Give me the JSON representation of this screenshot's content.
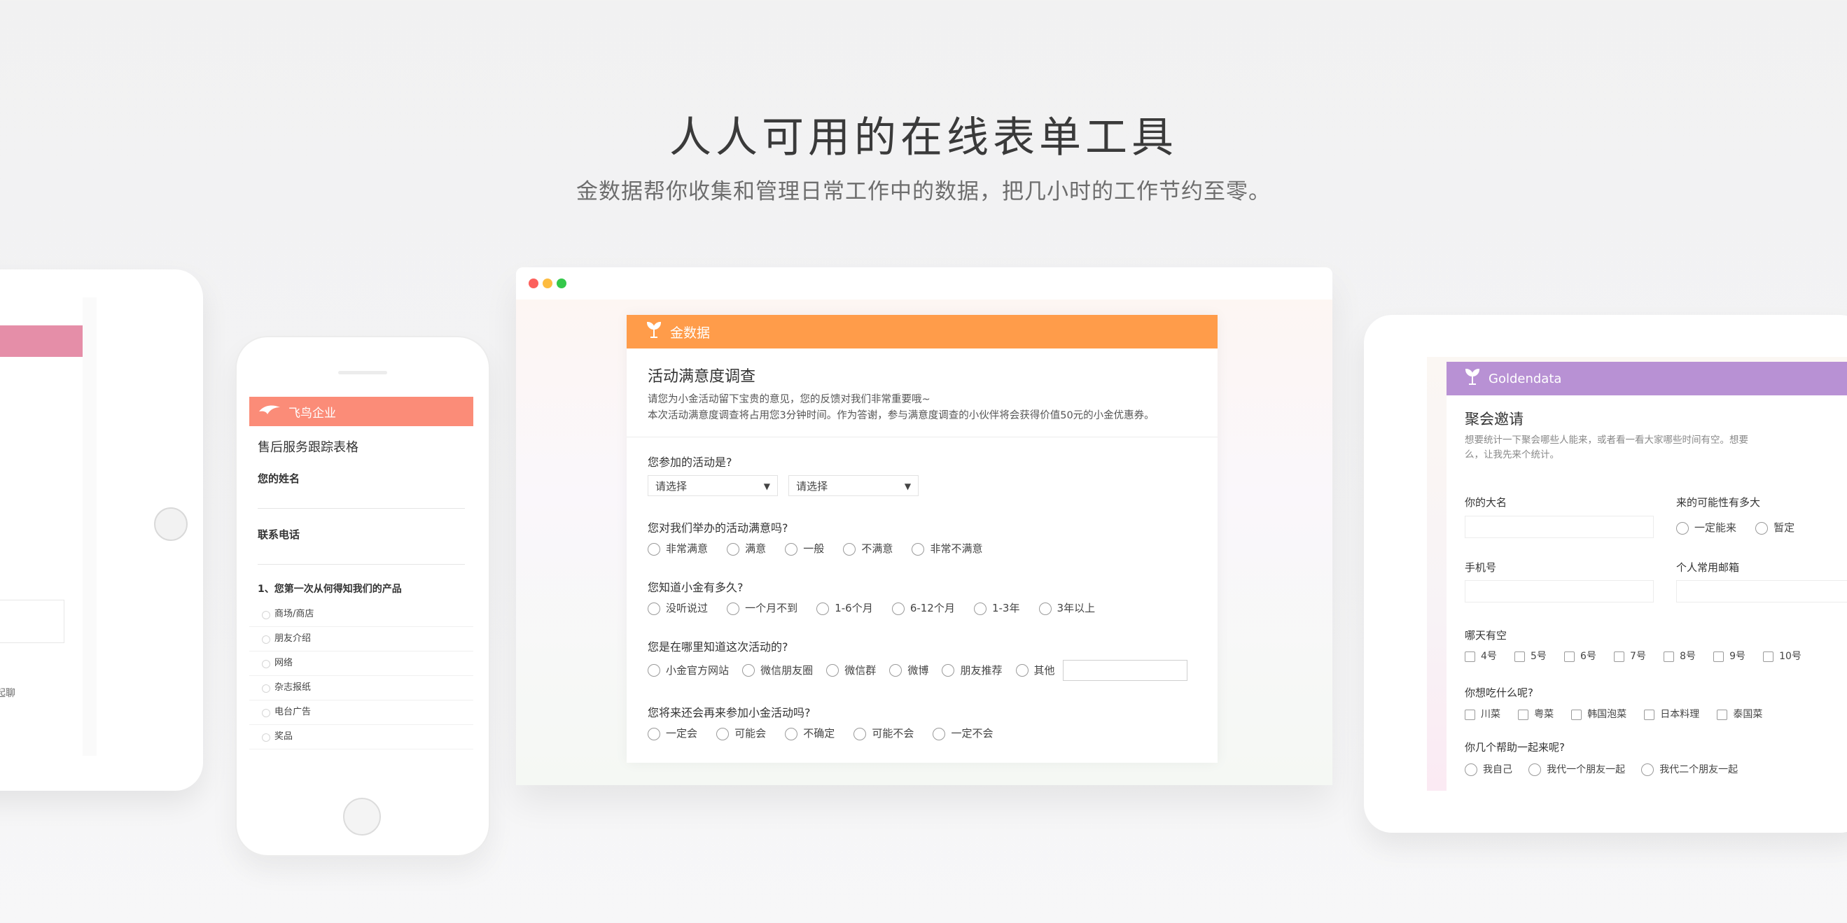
{
  "hero": {
    "title": "人人可用的在线表单工具",
    "subtitle": "金数据帮你收集和管理日常工作中的数据，把几小时的工作节约至零。"
  },
  "colors": {
    "phone_header": "#fb8c78",
    "browser_header": "#ff9c4a",
    "tablet_header": "#b891d4",
    "left_tablet_header": "#e58ea8"
  },
  "left_tablet": {
    "fragment_text": "一起聊"
  },
  "phone": {
    "logo_icon": "bird-logo-icon",
    "brand": "飞鸟企业",
    "form_title": "售后服务跟踪表格",
    "fields": [
      {
        "label": "您的姓名"
      },
      {
        "label": "联系电话"
      }
    ],
    "question": "1、您第一次从何得知我们的产品",
    "options": [
      "商场/商店",
      "朋友介绍",
      "网络",
      "杂志报纸",
      "电台广告",
      "奖品"
    ]
  },
  "browser": {
    "logo_icon": "sprout-logo-icon",
    "brand": "金数据",
    "form_title": "活动满意度调查",
    "desc_line1": "请您为小金活动留下宝贵的意见，您的反馈对我们非常重要哦~",
    "desc_line2": "本次活动满意度调查将占用您3分钟时间。作为答谢，参与满意度调查的小伙伴将会获得价值50元的小金优惠券。",
    "q1": {
      "label": "您参加的活动是?",
      "select1": "请选择",
      "select2": "请选择"
    },
    "q2": {
      "label": "您对我们举办的活动满意吗?",
      "options": [
        "非常满意",
        "满意",
        "一般",
        "不满意",
        "非常不满意"
      ]
    },
    "q3": {
      "label": "您知道小金有多久?",
      "options": [
        "没听说过",
        "一个月不到",
        "1-6个月",
        "6-12个月",
        "1-3年",
        "3年以上"
      ]
    },
    "q4": {
      "label": "您是在哪里知道这次活动的?",
      "options": [
        "小金官方网站",
        "微信朋友圈",
        "微信群",
        "微博",
        "朋友推荐",
        "其他"
      ]
    },
    "q5": {
      "label": "您将来还会再来参加小金活动吗?",
      "options": [
        "一定会",
        "可能会",
        "不确定",
        "可能不会",
        "一定不会"
      ]
    }
  },
  "right_tablet": {
    "logo_icon": "sprout-logo-icon",
    "brand": "Goldendata",
    "form_title": "聚会邀请",
    "desc_line1": "想要统计一下聚会哪些人能来，或者看一看大家哪些时间有空。想要",
    "desc_line2": "么，让我先来个统计。",
    "name_label": "你的大名",
    "possibility_label": "来的可能性有多大",
    "possibility_options": [
      "一定能来",
      "暂定"
    ],
    "phone_label": "手机号",
    "email_label": "个人常用邮箱",
    "days_label": "哪天有空",
    "days": [
      "4号",
      "5号",
      "6号",
      "7号",
      "8号",
      "9号",
      "10号"
    ],
    "food_label": "你想吃什么呢?",
    "foods": [
      "川菜",
      "粤菜",
      "韩国泡菜",
      "日本料理",
      "泰国菜"
    ],
    "companions_label": "你几个帮助一起来呢?",
    "companions": [
      "我自己",
      "我代一个朋友一起",
      "我代二个朋友一起"
    ]
  }
}
